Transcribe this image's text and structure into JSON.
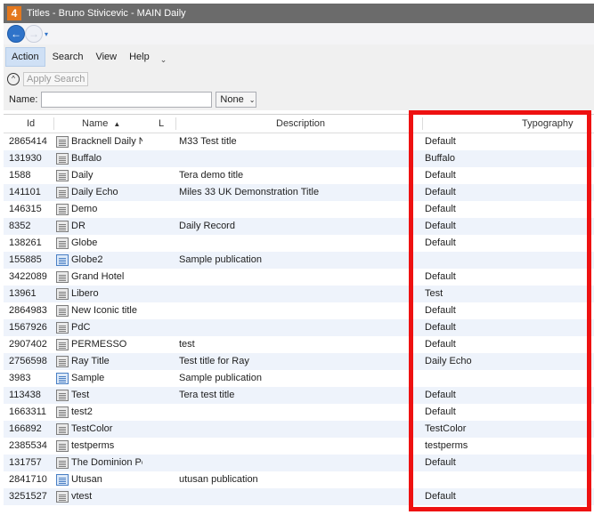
{
  "window": {
    "title": "Titles - Bruno Stivicevic - MAIN Daily",
    "logo": "4"
  },
  "nav": {
    "back_icon": "arrow-left-icon",
    "forward_icon": "arrow-right-icon",
    "dropdown": "▾"
  },
  "menu": {
    "items": [
      {
        "label": "Action",
        "active": true
      },
      {
        "label": "Search",
        "active": false
      },
      {
        "label": "View",
        "active": false
      },
      {
        "label": "Help",
        "active": false
      }
    ],
    "more": "⌄"
  },
  "search": {
    "collapse_icon": "^",
    "apply_label": "Apply Search"
  },
  "name_filter": {
    "label": "Name:",
    "value": "",
    "mode": "None"
  },
  "grid": {
    "columns": {
      "id": "Id",
      "name": "Name",
      "sort_indicator": "▲",
      "l": "L",
      "description": "Description",
      "typography": "Typography"
    },
    "rows": [
      {
        "id": "2865414",
        "name": "Bracknell Daily N",
        "icon": "doc-gray",
        "description": "M33 Test title",
        "typography": "Default"
      },
      {
        "id": "131930",
        "name": "Buffalo",
        "icon": "doc-gray",
        "description": "",
        "typography": "Buffalo"
      },
      {
        "id": "1588",
        "name": "Daily",
        "icon": "doc-gray",
        "description": "Tera demo title",
        "typography": "Default"
      },
      {
        "id": "141101",
        "name": "Daily Echo",
        "icon": "doc-gray",
        "description": "Miles 33 UK Demonstration Title",
        "typography": "Default"
      },
      {
        "id": "146315",
        "name": "Demo",
        "icon": "doc-gray",
        "description": "",
        "typography": "Default"
      },
      {
        "id": "8352",
        "name": "DR",
        "icon": "doc-gray",
        "description": "Daily Record",
        "typography": "Default"
      },
      {
        "id": "138261",
        "name": "Globe",
        "icon": "doc-gray",
        "description": "",
        "typography": "Default"
      },
      {
        "id": "155885",
        "name": "Globe2",
        "icon": "doc-blue",
        "description": "Sample publication",
        "typography": ""
      },
      {
        "id": "3422089",
        "name": "Grand Hotel",
        "icon": "doc-gray",
        "description": "",
        "typography": "Default"
      },
      {
        "id": "13961",
        "name": "Libero",
        "icon": "doc-gray",
        "description": "",
        "typography": "Test"
      },
      {
        "id": "2864983",
        "name": "New Iconic title",
        "icon": "doc-gray",
        "description": "",
        "typography": "Default"
      },
      {
        "id": "1567926",
        "name": "PdC",
        "icon": "doc-gray",
        "description": "",
        "typography": "Default"
      },
      {
        "id": "2907402",
        "name": "PERMESSO",
        "icon": "doc-gray",
        "description": "test",
        "typography": "Default"
      },
      {
        "id": "2756598",
        "name": "Ray Title",
        "icon": "doc-gray",
        "description": "Test title for Ray",
        "typography": "Daily Echo"
      },
      {
        "id": "3983",
        "name": "Sample",
        "icon": "doc-blue",
        "description": "Sample publication",
        "typography": ""
      },
      {
        "id": "113438",
        "name": "Test",
        "icon": "doc-gray",
        "description": "Tera test title",
        "typography": "Default"
      },
      {
        "id": "1663311",
        "name": "test2",
        "icon": "doc-gray",
        "description": "",
        "typography": "Default"
      },
      {
        "id": "166892",
        "name": "TestColor",
        "icon": "doc-gray",
        "description": "",
        "typography": "TestColor"
      },
      {
        "id": "2385534",
        "name": "testperms",
        "icon": "doc-gray",
        "description": "",
        "typography": "testperms"
      },
      {
        "id": "131757",
        "name": "The Dominion Pc",
        "icon": "doc-gray",
        "description": "",
        "typography": "Default"
      },
      {
        "id": "2841710",
        "name": "Utusan",
        "icon": "doc-blue",
        "description": "utusan publication",
        "typography": ""
      },
      {
        "id": "3251527",
        "name": "vtest",
        "icon": "doc-gray",
        "description": "",
        "typography": "Default"
      }
    ]
  },
  "colors": {
    "highlight_border": "#ee1111",
    "accent": "#2f73c9",
    "alt_row": "#eef3fb"
  }
}
